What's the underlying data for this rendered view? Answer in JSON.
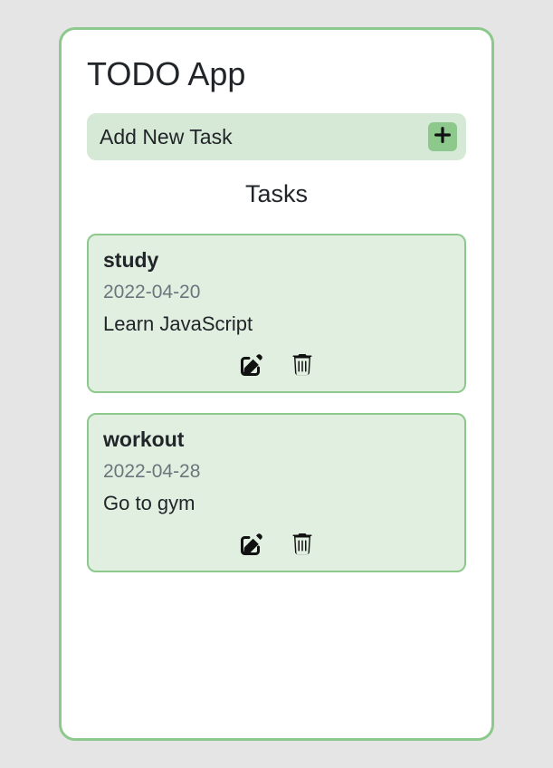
{
  "app": {
    "title": "TODO App"
  },
  "addTask": {
    "label": "Add New Task"
  },
  "tasksSection": {
    "heading": "Tasks"
  },
  "tasks": [
    {
      "title": "study",
      "date": "2022-04-20",
      "description": "Learn JavaScript"
    },
    {
      "title": "workout",
      "date": "2022-04-28",
      "description": "Go to gym"
    }
  ]
}
